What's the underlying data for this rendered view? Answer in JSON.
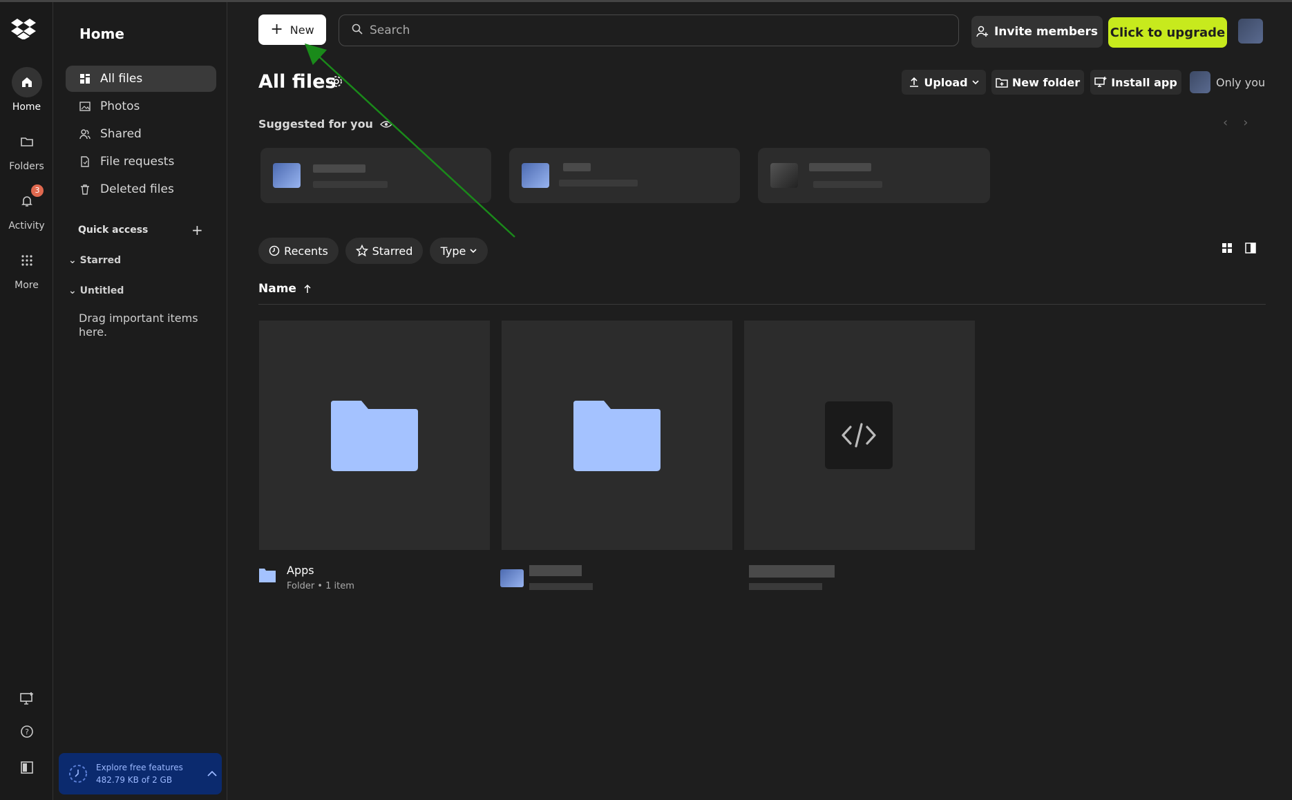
{
  "rail": {
    "items": [
      {
        "label": "Home"
      },
      {
        "label": "Folders"
      },
      {
        "label": "Activity",
        "badge": "3"
      },
      {
        "label": "More"
      }
    ]
  },
  "sidebar": {
    "title": "Home",
    "items": [
      {
        "label": "All files"
      },
      {
        "label": "Photos"
      },
      {
        "label": "Shared"
      },
      {
        "label": "File requests"
      },
      {
        "label": "Deleted files"
      }
    ],
    "quick_access": "Quick access",
    "starred": "Starred",
    "untitled": "Untitled",
    "drag_hint": "Drag important items here.",
    "explore": {
      "title": "Explore free features",
      "usage": "482.79 KB of 2 GB"
    }
  },
  "header": {
    "new_label": "New",
    "search_placeholder": "Search",
    "invite_label": "Invite members",
    "upgrade_label": "Click to upgrade"
  },
  "page": {
    "title": "All files",
    "upload_label": "Upload",
    "new_folder_label": "New folder",
    "install_app_label": "Install app",
    "sharing_label": "Only you",
    "suggested_label": "Suggested for you"
  },
  "filters": {
    "recents": "Recents",
    "starred": "Starred",
    "type": "Type"
  },
  "list": {
    "sort_column": "Name",
    "files": [
      {
        "name": "Apps",
        "meta": "Folder • 1 item",
        "kind": "folder"
      },
      {
        "name": "",
        "meta": "",
        "kind": "folder"
      },
      {
        "name": "",
        "meta": "",
        "kind": "code"
      }
    ]
  },
  "colors": {
    "accent_upgrade": "#c7ea1d",
    "folder_blue": "#a4c2ff",
    "badge": "#e0694f",
    "explore_bg": "#0b2a6e",
    "annotation_arrow": "#1a8a1a"
  }
}
